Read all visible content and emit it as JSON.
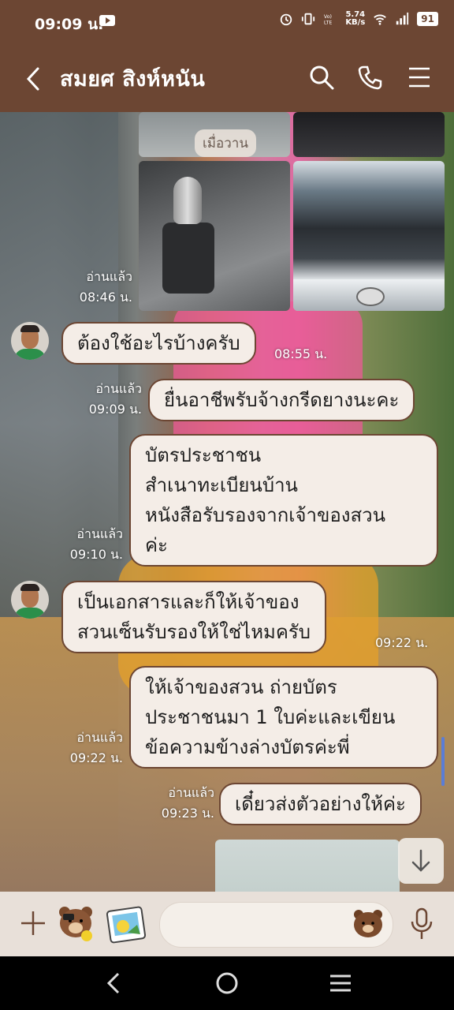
{
  "status_bar": {
    "time": "09:09 น.",
    "network_speed": "5.74\nKB/s",
    "battery": "91",
    "icons": [
      "youtube-icon",
      "alarm-icon",
      "vibrate-icon",
      "volte-icon",
      "wifi-icon",
      "signal-icon",
      "battery-icon"
    ]
  },
  "header": {
    "contact_name": "สมยศ  สิงห์หนัน",
    "icons": [
      "back-arrow-icon",
      "search-icon",
      "phone-icon",
      "menu-icon"
    ]
  },
  "chat": {
    "date_divider": "เมื่อวาน",
    "photo_group": {
      "read_label": "อ่านแล้ว",
      "time": "08:46 น."
    },
    "messages": [
      {
        "direction": "in",
        "text": "ต้องใช้อะไรบ้างครับ",
        "time": "08:55 น."
      },
      {
        "direction": "out",
        "text": "ยื่นอาชีพรับจ้างกรีดยางนะคะ",
        "read_label": "อ่านแล้ว",
        "time": "09:09 น."
      },
      {
        "direction": "out",
        "lines": [
          "บัตรประชาชน",
          "สำเนาทะเบียนบ้าน",
          "หนังสือรับรองจากเจ้าของสวน",
          "ค่ะ"
        ],
        "read_label": "อ่านแล้ว",
        "time": "09:10 น."
      },
      {
        "direction": "in",
        "lines": [
          "เป็นเอกสารและก็ให้เจ้าของ",
          "สวนเซ็นรับรองให้ใช่ไหมครับ"
        ],
        "time": "09:22 น."
      },
      {
        "direction": "out",
        "lines": [
          "ให้เจ้าของสวน ถ่ายบัตร",
          "ประชาชนมา 1 ใบค่ะและเขียน",
          "ข้อความข้างล่างบัตรค่ะพี่"
        ],
        "read_label": "อ่านแล้ว",
        "time": "09:22 น."
      },
      {
        "direction": "out",
        "text": "เดี๋ยวส่งตัวอย่างให้ค่ะ",
        "read_label": "อ่านแล้ว",
        "time": "09:23 น."
      }
    ]
  },
  "input_bar": {
    "placeholder": "",
    "icons": [
      "plus-icon",
      "brown-bear-sticker-icon",
      "photo-sticker-icon",
      "emoji-icon",
      "microphone-icon"
    ]
  },
  "nav_bar": {
    "icons": [
      "nav-back-icon",
      "nav-home-icon",
      "nav-recents-icon"
    ]
  },
  "colors": {
    "header_bg": "#6c4633",
    "bubble_bg": "#f4ede7",
    "bubble_border": "#6c4633",
    "input_bar_bg": "#e8e0d9"
  }
}
